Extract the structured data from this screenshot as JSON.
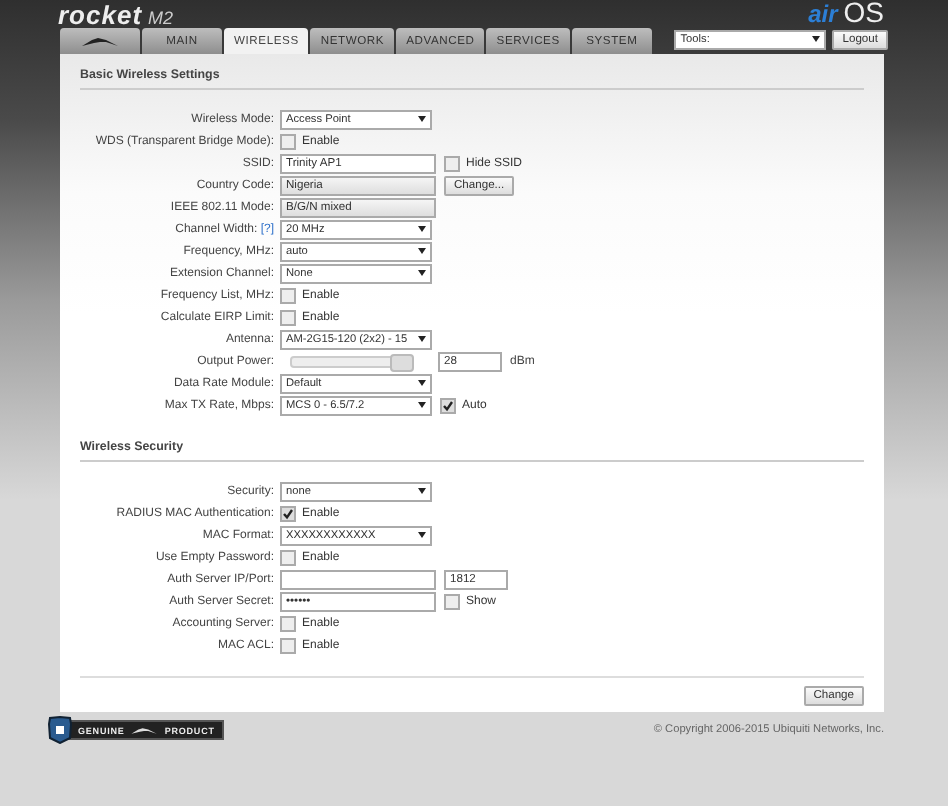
{
  "header": {
    "product": "rocket",
    "model": "M2",
    "brand_prefix": "air",
    "brand_suffix": "OS"
  },
  "tabs": [
    {
      "kind": "logo",
      "selected": false
    },
    {
      "label": "MAIN",
      "selected": false
    },
    {
      "label": "WIRELESS",
      "selected": true
    },
    {
      "label": "NETWORK",
      "selected": false
    },
    {
      "label": "ADVANCED",
      "selected": false
    },
    {
      "label": "SERVICES",
      "selected": false
    },
    {
      "label": "SYSTEM",
      "selected": false
    }
  ],
  "tools": {
    "value": "Tools:"
  },
  "logout": "Logout",
  "sections": [
    {
      "title": "Basic Wireless Settings",
      "rows": [
        {
          "label": "Wireless Mode:",
          "controls": [
            {
              "kind": "select",
              "value": "Access Point"
            }
          ]
        },
        {
          "label": "WDS (Transparent Bridge Mode):",
          "controls": [
            {
              "kind": "checkbox",
              "checked": false,
              "text": "Enable"
            }
          ]
        },
        {
          "label": "SSID:",
          "controls": [
            {
              "kind": "text",
              "value": "Trinity AP1"
            },
            {
              "kind": "checkbox",
              "checked": false,
              "text": "Hide SSID"
            }
          ]
        },
        {
          "label": "Country Code:",
          "controls": [
            {
              "kind": "readonly",
              "value": "Nigeria"
            },
            {
              "kind": "button",
              "text": "Change..."
            }
          ]
        },
        {
          "label": "IEEE 802.11 Mode:",
          "controls": [
            {
              "kind": "readonly",
              "value": "B/G/N mixed"
            }
          ]
        },
        {
          "label": "Channel Width:",
          "help": "[?]",
          "controls": [
            {
              "kind": "select",
              "value": "20 MHz"
            }
          ]
        },
        {
          "label": "Frequency, MHz:",
          "controls": [
            {
              "kind": "select",
              "value": "auto"
            }
          ]
        },
        {
          "label": "Extension Channel:",
          "controls": [
            {
              "kind": "select",
              "value": "None"
            }
          ]
        },
        {
          "label": "Frequency List, MHz:",
          "controls": [
            {
              "kind": "checkbox",
              "checked": false,
              "text": "Enable"
            }
          ]
        },
        {
          "label": "Calculate EIRP Limit:",
          "controls": [
            {
              "kind": "checkbox",
              "checked": false,
              "text": "Enable"
            }
          ]
        },
        {
          "label": "Antenna:",
          "controls": [
            {
              "kind": "select",
              "value": "AM-2G15-120 (2x2) - 15"
            }
          ]
        },
        {
          "label": "Output Power:",
          "controls": [
            {
              "kind": "slider",
              "level": 0.95
            },
            {
              "kind": "short",
              "value": "28"
            },
            {
              "kind": "unit",
              "text": "dBm"
            }
          ]
        },
        {
          "label": "Data Rate Module:",
          "controls": [
            {
              "kind": "select",
              "value": "Default"
            }
          ]
        },
        {
          "label": "Max TX Rate, Mbps:",
          "controls": [
            {
              "kind": "select",
              "value": "MCS 0 - 6.5/7.2"
            },
            {
              "kind": "checkbox",
              "checked": true,
              "text": "Auto"
            }
          ]
        }
      ]
    },
    {
      "title": "Wireless Security",
      "rows": [
        {
          "label": "Security:",
          "controls": [
            {
              "kind": "select",
              "value": "none"
            }
          ]
        },
        {
          "label": "RADIUS MAC Authentication:",
          "controls": [
            {
              "kind": "checkbox",
              "checked": true,
              "text": "Enable"
            }
          ]
        },
        {
          "label": "MAC Format:",
          "controls": [
            {
              "kind": "select",
              "value": "XXXXXXXXXXXX"
            }
          ]
        },
        {
          "label": "Use Empty Password:",
          "controls": [
            {
              "kind": "checkbox",
              "checked": false,
              "text": "Enable"
            }
          ]
        },
        {
          "label": "Auth Server IP/Port:",
          "controls": [
            {
              "kind": "text"
            },
            {
              "kind": "short",
              "value": "1812"
            }
          ]
        },
        {
          "label": "Auth Server Secret:",
          "controls": [
            {
              "kind": "text",
              "value": "••••••"
            },
            {
              "kind": "checkbox",
              "checked": false,
              "text": "Show"
            }
          ]
        },
        {
          "label": "Accounting Server:",
          "controls": [
            {
              "kind": "checkbox",
              "checked": false,
              "text": "Enable"
            }
          ]
        },
        {
          "label": "MAC ACL:",
          "controls": [
            {
              "kind": "checkbox",
              "checked": false,
              "text": "Enable"
            }
          ]
        }
      ]
    }
  ],
  "submit": "Change",
  "badge": {
    "left": "GENUINE",
    "right": "PRODUCT"
  },
  "copyright": "© Copyright 2006-2015 Ubiquiti Networks, Inc."
}
